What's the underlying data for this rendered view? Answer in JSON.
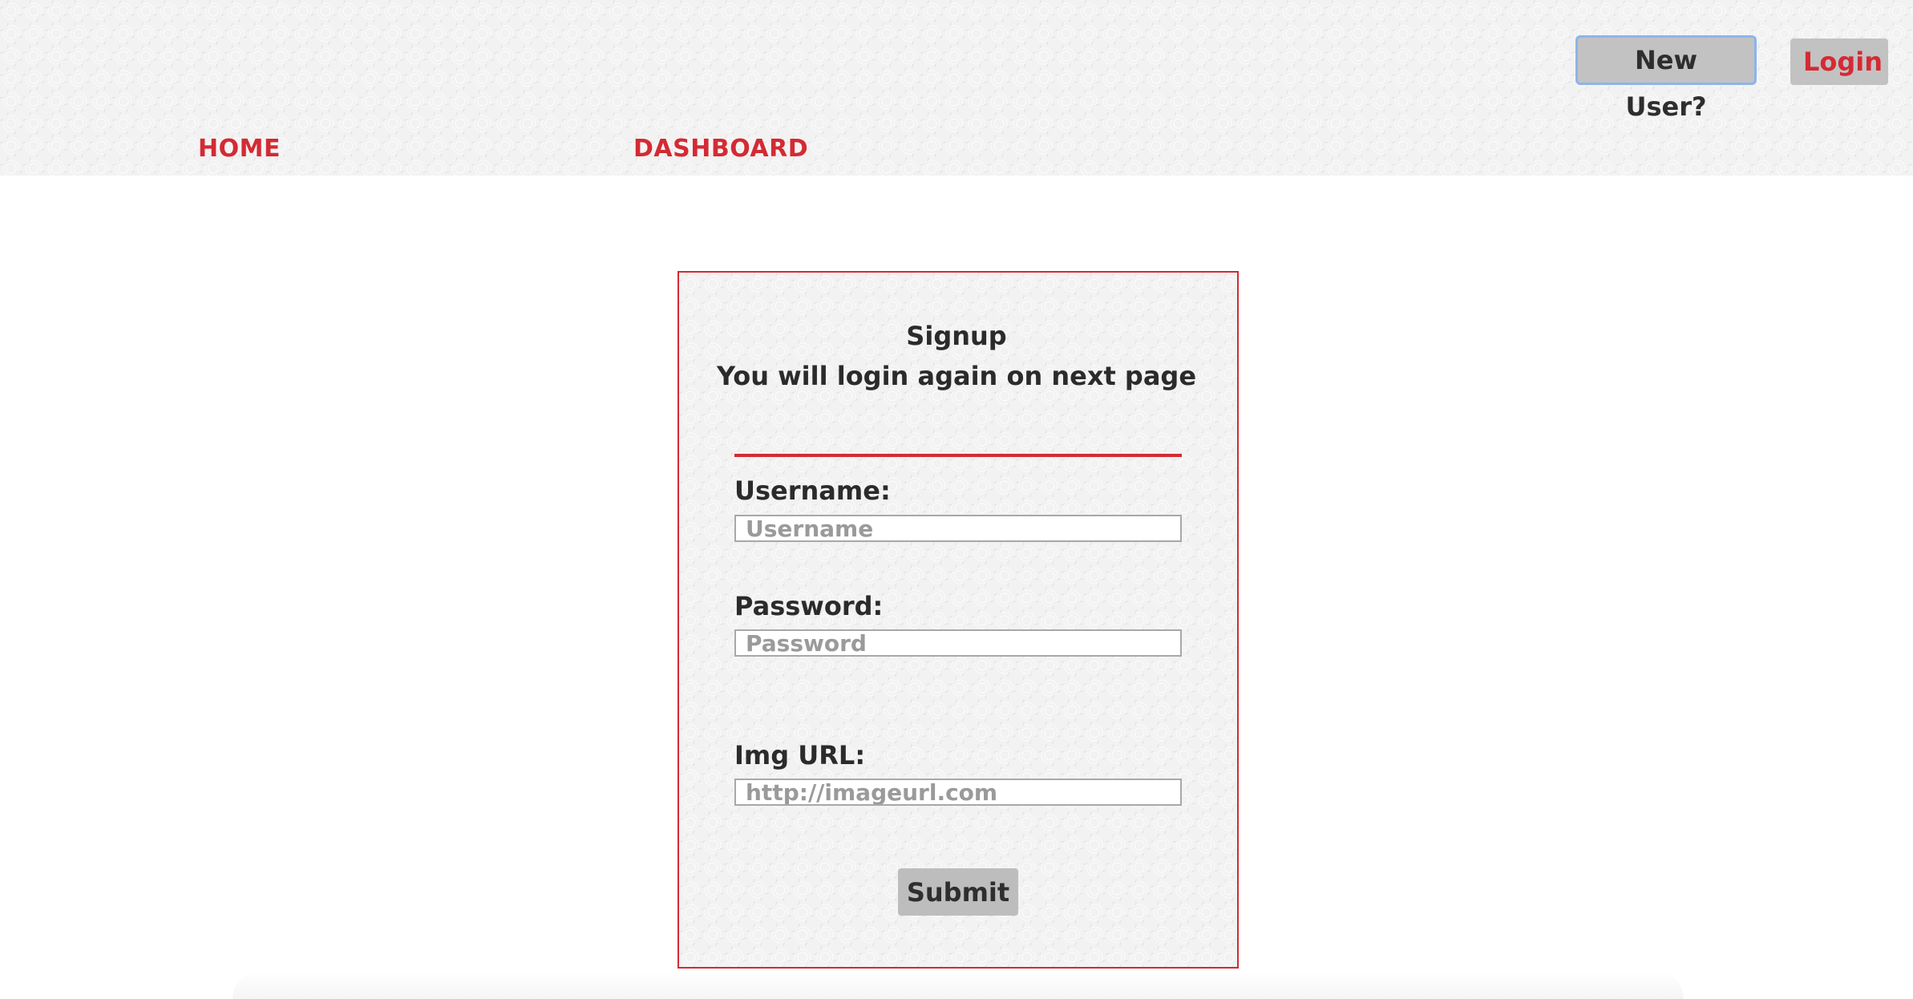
{
  "header": {
    "new_user_label": "New User?",
    "login_label": "Login",
    "nav": {
      "home_label": "HOME",
      "dashboard_label": "DASHBOARD"
    }
  },
  "signup_form": {
    "title": "Signup",
    "subtitle": "You will login again on next page",
    "username": {
      "label": "Username:",
      "value": "",
      "placeholder": "Username"
    },
    "password": {
      "label": "Password:",
      "value": "",
      "placeholder": "Password"
    },
    "img_url": {
      "label": "Img URL:",
      "value": "",
      "placeholder": "http://imageurl.com"
    },
    "submit_label": "Submit"
  },
  "colors": {
    "accent": "#d42a33",
    "button_bg": "#c2c2c2",
    "focus_outline": "#8db4ea"
  }
}
